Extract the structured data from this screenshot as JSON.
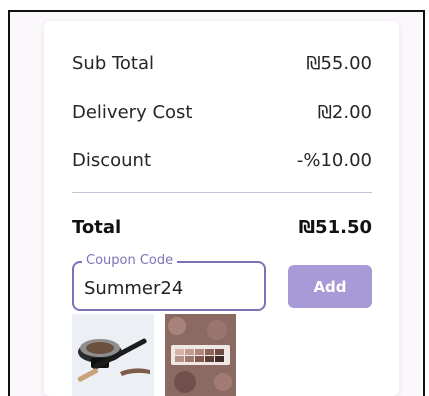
{
  "summary": {
    "subtotal": {
      "label": "Sub Total",
      "value": "₪55.00"
    },
    "delivery": {
      "label": "Delivery Cost",
      "value": "₪2.00"
    },
    "discount": {
      "label": "Discount",
      "value": "-%10.00"
    },
    "total": {
      "label": "Total",
      "value": "₪51.50"
    }
  },
  "coupon": {
    "label": "Coupon Code",
    "value": "Summer24",
    "add_label": "Add"
  },
  "products": [
    {
      "image": "brow-pomade-and-brush-image"
    },
    {
      "image": "eyeshadow-palette-image"
    }
  ],
  "colors": {
    "accent": "#7d72b8",
    "button": "#a79ad6",
    "divider": "#c9c1d6"
  }
}
